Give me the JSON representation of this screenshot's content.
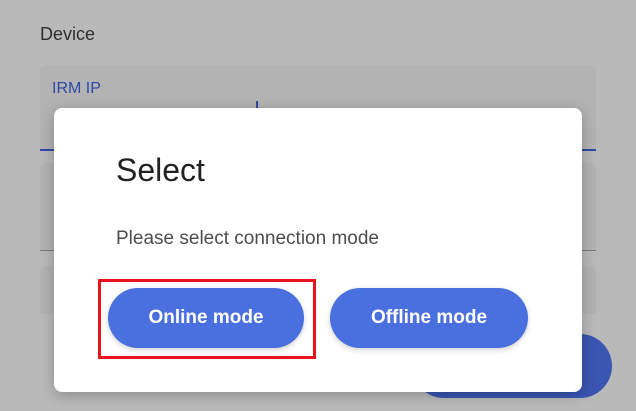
{
  "background_form": {
    "section_label": "Device",
    "ip_field_label": "IRM IP"
  },
  "dialog": {
    "title": "Select",
    "message": "Please select connection mode",
    "online_button_label": "Online mode",
    "offline_button_label": "Offline mode"
  },
  "colors": {
    "overlay_background": "#b9b9b9",
    "dialog_background": "#ffffff",
    "button_primary": "#4a6fde",
    "field_accent": "#2e48a8",
    "highlight_outline": "#e8141b"
  }
}
